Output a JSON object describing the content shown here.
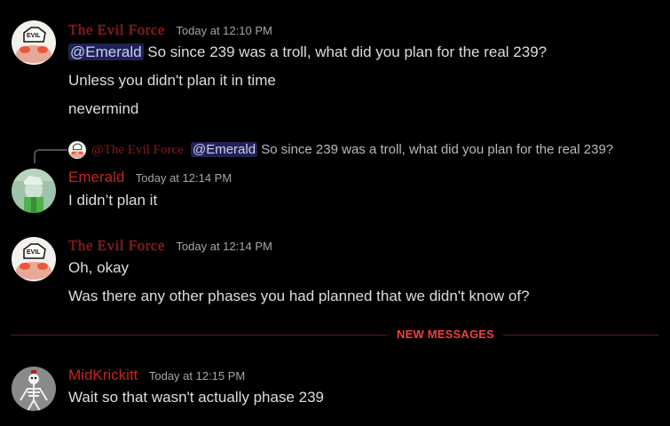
{
  "colors": {
    "background": "#000000",
    "evil_force_name": "#8a1a1a",
    "emerald_name": "#c4271f",
    "mention_bg": "#3b3f8f",
    "new_messages": "#f23f43"
  },
  "messages": [
    {
      "author": "The Evil Force",
      "timestamp": "Today at 12:10 PM",
      "avatar_icon": "evil-force-avatar-icon",
      "lines": [
        {
          "mention": "@Emerald",
          "text": " So since 239 was a troll, what did you plan for the real 239?"
        },
        {
          "text": "Unless you didn't plan it in time"
        },
        {
          "text": "nevermind"
        }
      ]
    },
    {
      "reply": {
        "author": "@The Evil Force",
        "mention": "@Emerald",
        "text": " So since 239 was a troll, what did you plan for the real 239?"
      },
      "author": "Emerald",
      "timestamp": "Today at 12:14 PM",
      "avatar_icon": "emerald-avatar-icon",
      "lines": [
        {
          "text": "I didn’t plan it"
        }
      ]
    },
    {
      "author": "The Evil Force",
      "timestamp": "Today at 12:14 PM",
      "avatar_icon": "evil-force-avatar-icon",
      "lines": [
        {
          "text": "Oh, okay"
        },
        {
          "text": "Was there any other phases you had planned that we didn't know of?"
        }
      ]
    },
    {
      "author": "MidKrickitt",
      "timestamp": "Today at 12:15 PM",
      "avatar_icon": "skeleton-avatar-icon",
      "lines": [
        {
          "text": "Wait so that wasn't actually phase 239"
        }
      ]
    }
  ],
  "divider": {
    "label": "NEW MESSAGES"
  }
}
